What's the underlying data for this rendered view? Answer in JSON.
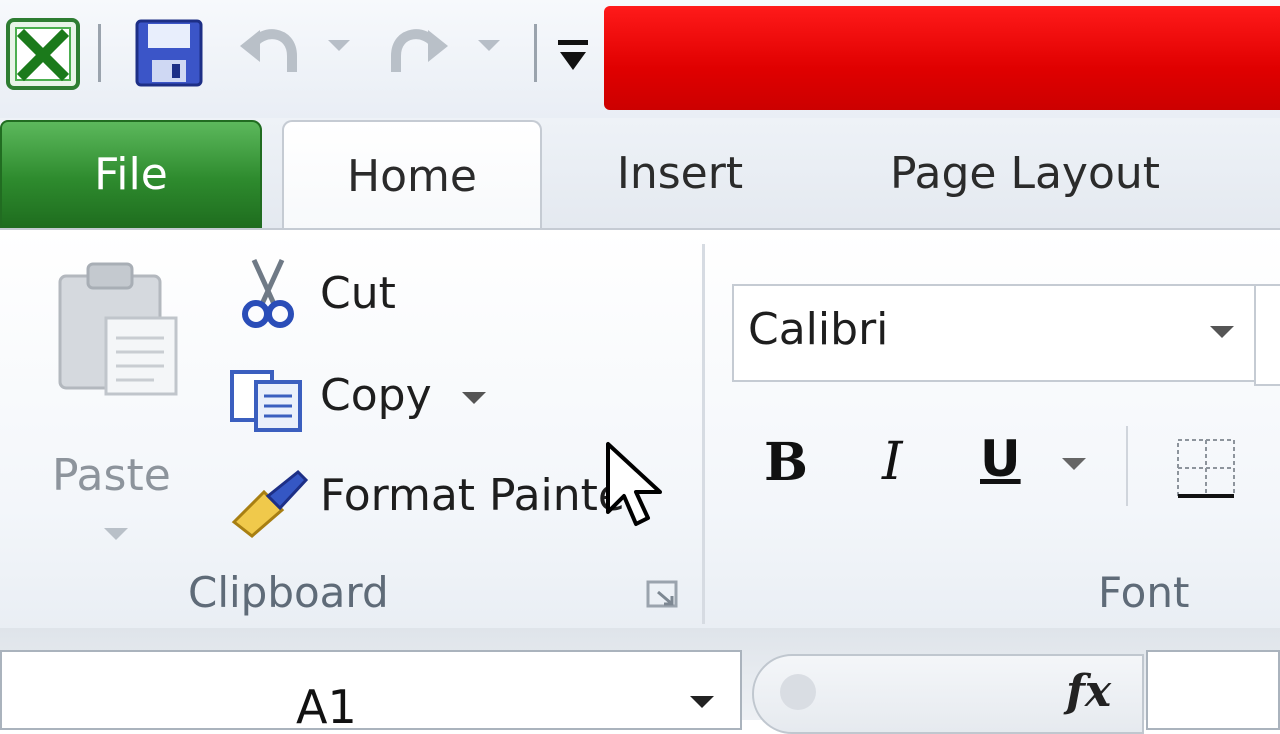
{
  "qat": {
    "excel_icon": "excel-icon",
    "save_icon": "save-icon",
    "undo_icon": "undo-icon",
    "redo_icon": "redo-icon",
    "customize_icon": "customize-qat-icon",
    "title_bar_color": "#e00000"
  },
  "tabs": {
    "file": "File",
    "home": "Home",
    "insert": "Insert",
    "page_layout": "Page Layout"
  },
  "clipboard": {
    "paste": "Paste",
    "cut": "Cut",
    "copy": "Copy",
    "format_painter": "Format Painter",
    "group_label": "Clipboard"
  },
  "font": {
    "font_name": "Calibri",
    "bold": "B",
    "italic": "I",
    "underline": "U",
    "group_label": "Font"
  },
  "formula_bar": {
    "name_box": "A1",
    "fx": "fx"
  },
  "colors": {
    "file_tab": "#2e8b2e",
    "ribbon_bg": "#f3f6fa"
  }
}
